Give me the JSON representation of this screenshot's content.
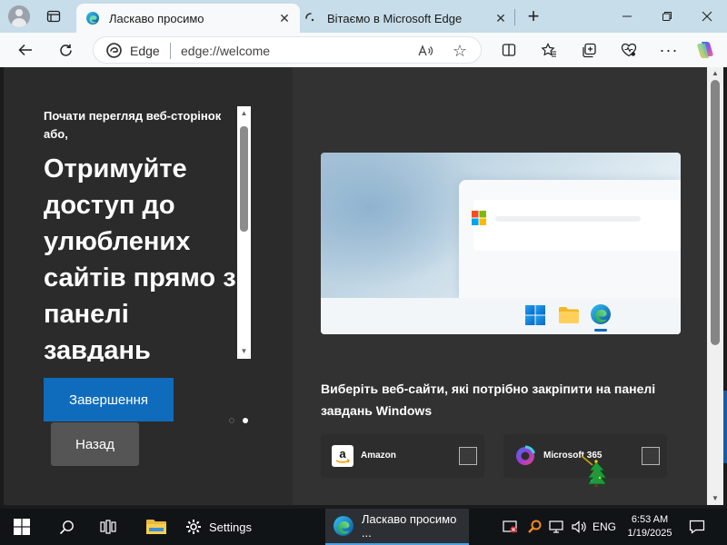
{
  "browser": {
    "tabs": [
      {
        "title": "Ласкаво просимо",
        "active": true
      },
      {
        "title": "Вітаємо в Microsoft Edge",
        "active": false
      }
    ],
    "address_bar": {
      "site_label": "Edge",
      "url": "edge://welcome"
    }
  },
  "welcome_page": {
    "intro": "Почати перегляд веб-сторінок або,",
    "headline": "Отримуйте доступ до улюблених сайтів прямо з панелі завдань Windows",
    "finish_button": "Завершення",
    "back_button": "Назад",
    "pagination": {
      "total": 2,
      "current": 2
    },
    "pin_prompt": "Виберіть веб-сайти, які потрібно закріпити на панелі завдань Windows",
    "sites": [
      {
        "name": "Amazon",
        "checked": false
      },
      {
        "name": "Microsoft 365",
        "checked": false
      }
    ]
  },
  "taskbar": {
    "settings_label": "Settings",
    "edge_label": "Ласкаво просимо ...",
    "language": "ENG",
    "time": "6:53 AM",
    "date": "1/19/2025"
  },
  "colors": {
    "accent": "#0f6cbd",
    "tabstrip": "#c7dde9",
    "panel_left": "#2b2b2b",
    "panel_right": "#323232",
    "taskbar": "#111417"
  },
  "icons": [
    "profile-icon",
    "tab-actions-icon",
    "edge-icon",
    "close-icon",
    "new-tab-icon",
    "minimize-icon",
    "maximize-icon",
    "back-arrow-icon",
    "refresh-icon",
    "read-aloud-icon",
    "favorite-star-icon",
    "split-screen-icon",
    "favorites-icon",
    "collections-icon",
    "performance-icon",
    "more-icon",
    "copilot-icon",
    "windows-start-icon",
    "search-icon",
    "task-view-icon",
    "file-explorer-icon",
    "gear-icon",
    "security-icon",
    "network-icon",
    "volume-icon",
    "notification-icon"
  ]
}
